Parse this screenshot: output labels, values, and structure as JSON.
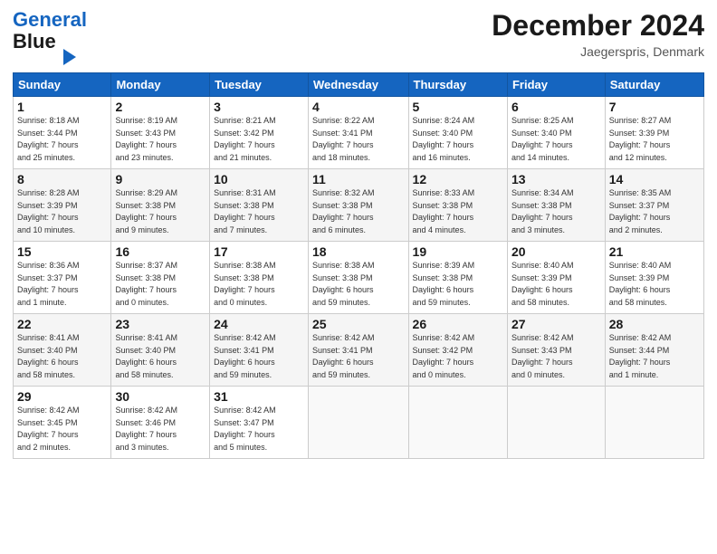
{
  "header": {
    "logo_line1": "General",
    "logo_line2": "Blue",
    "month_title": "December 2024",
    "location": "Jaegerspris, Denmark"
  },
  "columns": [
    "Sunday",
    "Monday",
    "Tuesday",
    "Wednesday",
    "Thursday",
    "Friday",
    "Saturday"
  ],
  "weeks": [
    [
      {
        "day": "1",
        "info": "Sunrise: 8:18 AM\nSunset: 3:44 PM\nDaylight: 7 hours\nand 25 minutes."
      },
      {
        "day": "2",
        "info": "Sunrise: 8:19 AM\nSunset: 3:43 PM\nDaylight: 7 hours\nand 23 minutes."
      },
      {
        "day": "3",
        "info": "Sunrise: 8:21 AM\nSunset: 3:42 PM\nDaylight: 7 hours\nand 21 minutes."
      },
      {
        "day": "4",
        "info": "Sunrise: 8:22 AM\nSunset: 3:41 PM\nDaylight: 7 hours\nand 18 minutes."
      },
      {
        "day": "5",
        "info": "Sunrise: 8:24 AM\nSunset: 3:40 PM\nDaylight: 7 hours\nand 16 minutes."
      },
      {
        "day": "6",
        "info": "Sunrise: 8:25 AM\nSunset: 3:40 PM\nDaylight: 7 hours\nand 14 minutes."
      },
      {
        "day": "7",
        "info": "Sunrise: 8:27 AM\nSunset: 3:39 PM\nDaylight: 7 hours\nand 12 minutes."
      }
    ],
    [
      {
        "day": "8",
        "info": "Sunrise: 8:28 AM\nSunset: 3:39 PM\nDaylight: 7 hours\nand 10 minutes."
      },
      {
        "day": "9",
        "info": "Sunrise: 8:29 AM\nSunset: 3:38 PM\nDaylight: 7 hours\nand 9 minutes."
      },
      {
        "day": "10",
        "info": "Sunrise: 8:31 AM\nSunset: 3:38 PM\nDaylight: 7 hours\nand 7 minutes."
      },
      {
        "day": "11",
        "info": "Sunrise: 8:32 AM\nSunset: 3:38 PM\nDaylight: 7 hours\nand 6 minutes."
      },
      {
        "day": "12",
        "info": "Sunrise: 8:33 AM\nSunset: 3:38 PM\nDaylight: 7 hours\nand 4 minutes."
      },
      {
        "day": "13",
        "info": "Sunrise: 8:34 AM\nSunset: 3:38 PM\nDaylight: 7 hours\nand 3 minutes."
      },
      {
        "day": "14",
        "info": "Sunrise: 8:35 AM\nSunset: 3:37 PM\nDaylight: 7 hours\nand 2 minutes."
      }
    ],
    [
      {
        "day": "15",
        "info": "Sunrise: 8:36 AM\nSunset: 3:37 PM\nDaylight: 7 hours\nand 1 minute."
      },
      {
        "day": "16",
        "info": "Sunrise: 8:37 AM\nSunset: 3:38 PM\nDaylight: 7 hours\nand 0 minutes."
      },
      {
        "day": "17",
        "info": "Sunrise: 8:38 AM\nSunset: 3:38 PM\nDaylight: 7 hours\nand 0 minutes."
      },
      {
        "day": "18",
        "info": "Sunrise: 8:38 AM\nSunset: 3:38 PM\nDaylight: 6 hours\nand 59 minutes."
      },
      {
        "day": "19",
        "info": "Sunrise: 8:39 AM\nSunset: 3:38 PM\nDaylight: 6 hours\nand 59 minutes."
      },
      {
        "day": "20",
        "info": "Sunrise: 8:40 AM\nSunset: 3:39 PM\nDaylight: 6 hours\nand 58 minutes."
      },
      {
        "day": "21",
        "info": "Sunrise: 8:40 AM\nSunset: 3:39 PM\nDaylight: 6 hours\nand 58 minutes."
      }
    ],
    [
      {
        "day": "22",
        "info": "Sunrise: 8:41 AM\nSunset: 3:40 PM\nDaylight: 6 hours\nand 58 minutes."
      },
      {
        "day": "23",
        "info": "Sunrise: 8:41 AM\nSunset: 3:40 PM\nDaylight: 6 hours\nand 58 minutes."
      },
      {
        "day": "24",
        "info": "Sunrise: 8:42 AM\nSunset: 3:41 PM\nDaylight: 6 hours\nand 59 minutes."
      },
      {
        "day": "25",
        "info": "Sunrise: 8:42 AM\nSunset: 3:41 PM\nDaylight: 6 hours\nand 59 minutes."
      },
      {
        "day": "26",
        "info": "Sunrise: 8:42 AM\nSunset: 3:42 PM\nDaylight: 7 hours\nand 0 minutes."
      },
      {
        "day": "27",
        "info": "Sunrise: 8:42 AM\nSunset: 3:43 PM\nDaylight: 7 hours\nand 0 minutes."
      },
      {
        "day": "28",
        "info": "Sunrise: 8:42 AM\nSunset: 3:44 PM\nDaylight: 7 hours\nand 1 minute."
      }
    ],
    [
      {
        "day": "29",
        "info": "Sunrise: 8:42 AM\nSunset: 3:45 PM\nDaylight: 7 hours\nand 2 minutes."
      },
      {
        "day": "30",
        "info": "Sunrise: 8:42 AM\nSunset: 3:46 PM\nDaylight: 7 hours\nand 3 minutes."
      },
      {
        "day": "31",
        "info": "Sunrise: 8:42 AM\nSunset: 3:47 PM\nDaylight: 7 hours\nand 5 minutes."
      },
      null,
      null,
      null,
      null
    ]
  ]
}
